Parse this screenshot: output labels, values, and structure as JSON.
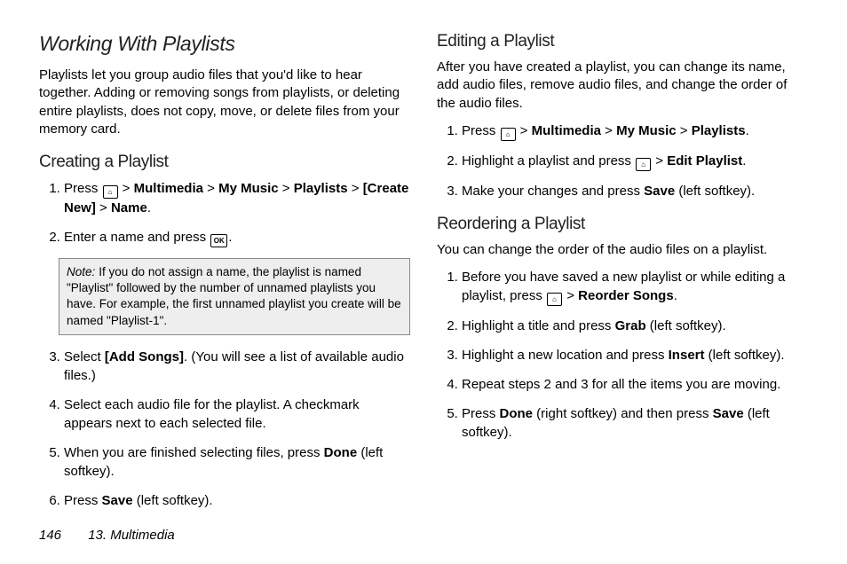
{
  "h1": "Working With Playlists",
  "intro": "Playlists let you group audio files that you'd like to hear together. Adding or removing songs from playlists, or deleting entire playlists, does not copy, move, or delete files from your memory card.",
  "creating": {
    "heading": "Creating a Playlist",
    "step1_a": "Press ",
    "step1_b": " > ",
    "step1_mm": "Multimedia",
    "step1_gt1": " > ",
    "step1_my": "My Music",
    "step1_gt2": " > ",
    "step1_pl": "Playlists",
    "step1_gt3": " > ",
    "step1_cn": "[Create New]",
    "step1_gt4": " > ",
    "step1_nm": "Name",
    "step1_dot": ".",
    "step2_a": "Enter a name and press ",
    "step2_dot": ".",
    "note_label": "Note:",
    "note_body": "If you do not assign a name, the playlist is named \"Playlist\" followed by the number of unnamed playlists you have. For example, the first unnamed playlist you create will be named \"Playlist-1\".",
    "step3_a": "Select ",
    "step3_b": "[Add Songs]",
    "step3_c": ". (You will see a list of available audio files.)",
    "step4": "Select each audio file for the playlist. A checkmark appears next to each selected file.",
    "step5_a": "When you are finished selecting files, press ",
    "step5_b": "Done",
    "step5_c": " (left softkey).",
    "step6_a": "Press ",
    "step6_b": "Save",
    "step6_c": " (left softkey)."
  },
  "editing": {
    "heading": "Editing a Playlist",
    "intro": "After you have created a playlist, you can change its name, add audio files, remove audio files, and change the order of the audio files.",
    "step1_a": "Press ",
    "step1_b": " > ",
    "step1_mm": "Multimedia",
    "step1_gt1": " > ",
    "step1_my": "My Music",
    "step1_gt2": " > ",
    "step1_pl": "Playlists",
    "step1_dot": ".",
    "step2_a": "Highlight a playlist and press ",
    "step2_b": " > ",
    "step2_ep": "Edit Playlist",
    "step2_dot": ".",
    "step3_a": "Make your changes and press ",
    "step3_b": "Save",
    "step3_c": " (left softkey)."
  },
  "reorder": {
    "heading": "Reordering a Playlist",
    "intro": "You can change the order of the audio files on a playlist.",
    "step1_a": "Before you have saved a new playlist or while editing a playlist, press ",
    "step1_b": " > ",
    "step1_rs": "Reorder Songs",
    "step1_dot": ".",
    "step2_a": "Highlight a title and press ",
    "step2_b": "Grab",
    "step2_c": " (left softkey).",
    "step3_a": "Highlight a new location and press ",
    "step3_b": "Insert",
    "step3_c": " (left softkey).",
    "step4": "Repeat steps 2 and 3 for all the items you are moving.",
    "step5_a": "Press ",
    "step5_b": "Done",
    "step5_c": " (right softkey) and then press ",
    "step5_d": "Save",
    "step5_e": " (left softkey)."
  },
  "footer": {
    "page": "146",
    "chapter": "13. Multimedia"
  },
  "icons": {
    "home": "⌂",
    "ok": "OK"
  }
}
